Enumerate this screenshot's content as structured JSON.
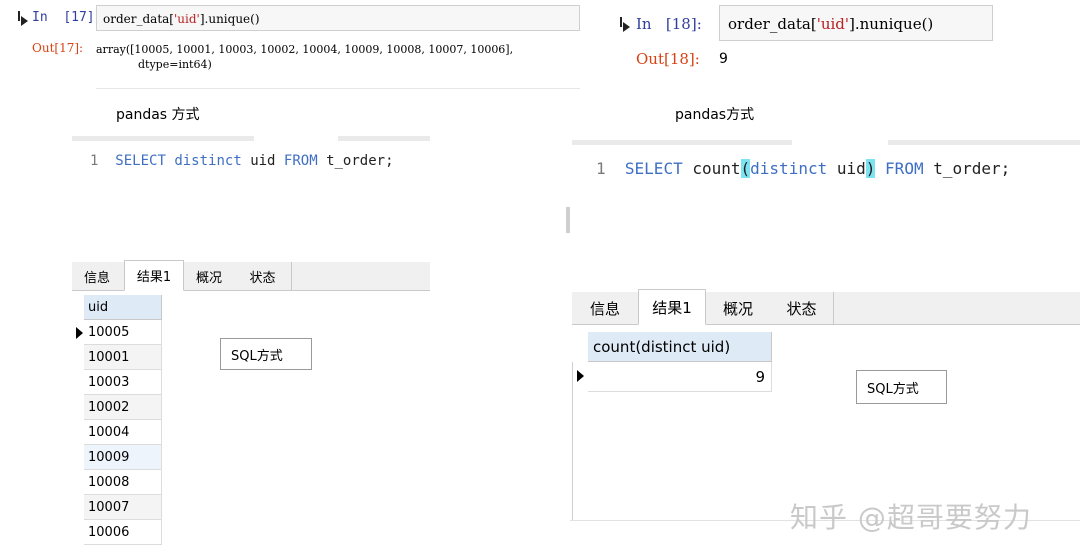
{
  "left": {
    "cell17": {
      "in_label": "In",
      "in_num": "[17]:",
      "code_pre": "order_data[",
      "code_str": "'uid'",
      "code_post": "].unique()",
      "out_label": "Out[17]:",
      "out_line1": "array([10005, 10001, 10003, 10002, 10004, 10009, 10008, 10007, 10006],",
      "out_line2": "dtype=int64)"
    },
    "caption": "pandas 方式",
    "sql": {
      "line_no": "1",
      "kw1": "SELECT",
      "w1": "distinct",
      "w2": "uid",
      "kw2": "FROM",
      "w3": "t_order;"
    },
    "tabs": [
      "信息",
      "结果1",
      "概况",
      "状态"
    ],
    "grid": {
      "header": "uid",
      "rows": [
        "10005",
        "10001",
        "10003",
        "10002",
        "10004",
        "10009",
        "10008",
        "10007",
        "10006"
      ]
    },
    "label": "SQL方式"
  },
  "right": {
    "cell18": {
      "in_label": "In",
      "in_num": "[18]:",
      "code_pre": "order_data[",
      "code_str": "'uid'",
      "code_post": "].nunique()",
      "out_label": "Out[18]:",
      "out_value": "9"
    },
    "caption": "pandas方式",
    "sql": {
      "line_no": "1",
      "kw1": "SELECT",
      "w_count": "count",
      "paren_open": "(",
      "w_distinct": "distinct",
      "w_uid": "uid",
      "paren_close": ")",
      "kw2": "FROM",
      "w_table": "t_order;"
    },
    "tabs": [
      "信息",
      "结果1",
      "概况",
      "状态"
    ],
    "grid": {
      "header": "count(distinct uid)",
      "value": "9"
    },
    "label": "SQL方式"
  },
  "watermark": "知乎 @超哥要努力"
}
